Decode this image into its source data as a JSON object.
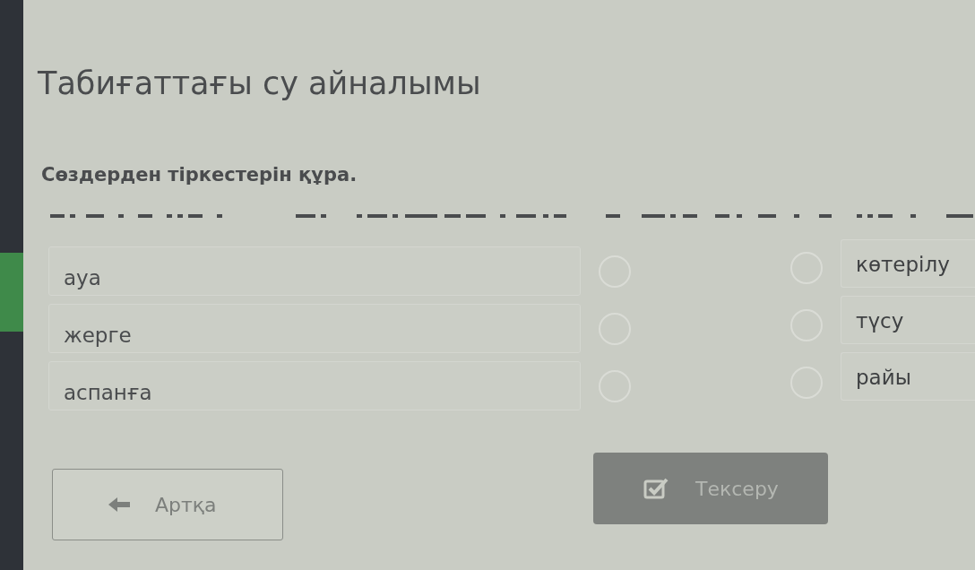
{
  "title": "Табиғаттағы су айналымы",
  "instruction": "Сөздерден тіркестерін құра.",
  "left_items": [
    {
      "text": "ауа"
    },
    {
      "text": "жерге"
    },
    {
      "text": "аспанға"
    }
  ],
  "right_items": [
    {
      "text": "көтерілу"
    },
    {
      "text": "түсу"
    },
    {
      "text": "райы"
    }
  ],
  "back_button": {
    "label": "Артқа"
  },
  "check_button": {
    "label": "Тексеру",
    "disabled": true
  }
}
